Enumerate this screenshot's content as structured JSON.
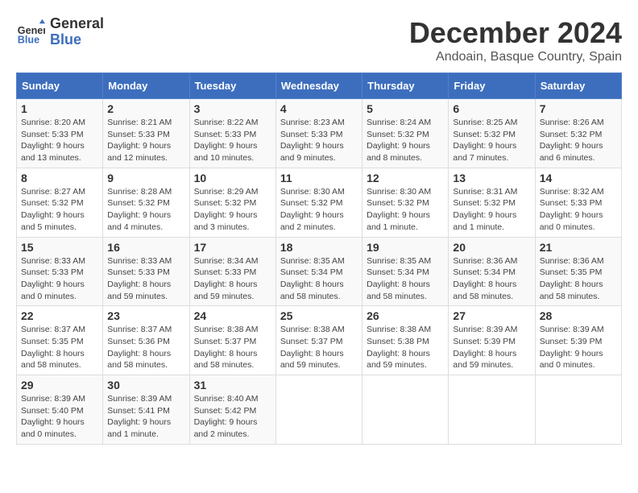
{
  "header": {
    "logo_line1": "General",
    "logo_line2": "Blue",
    "main_title": "December 2024",
    "subtitle": "Andoain, Basque Country, Spain"
  },
  "calendar": {
    "days_of_week": [
      "Sunday",
      "Monday",
      "Tuesday",
      "Wednesday",
      "Thursday",
      "Friday",
      "Saturday"
    ],
    "weeks": [
      [
        {
          "day": "1",
          "sunrise": "8:20 AM",
          "sunset": "5:33 PM",
          "daylight": "9 hours and 13 minutes."
        },
        {
          "day": "2",
          "sunrise": "8:21 AM",
          "sunset": "5:33 PM",
          "daylight": "9 hours and 12 minutes."
        },
        {
          "day": "3",
          "sunrise": "8:22 AM",
          "sunset": "5:33 PM",
          "daylight": "9 hours and 10 minutes."
        },
        {
          "day": "4",
          "sunrise": "8:23 AM",
          "sunset": "5:33 PM",
          "daylight": "9 hours and 9 minutes."
        },
        {
          "day": "5",
          "sunrise": "8:24 AM",
          "sunset": "5:32 PM",
          "daylight": "9 hours and 8 minutes."
        },
        {
          "day": "6",
          "sunrise": "8:25 AM",
          "sunset": "5:32 PM",
          "daylight": "9 hours and 7 minutes."
        },
        {
          "day": "7",
          "sunrise": "8:26 AM",
          "sunset": "5:32 PM",
          "daylight": "9 hours and 6 minutes."
        }
      ],
      [
        {
          "day": "8",
          "sunrise": "8:27 AM",
          "sunset": "5:32 PM",
          "daylight": "9 hours and 5 minutes."
        },
        {
          "day": "9",
          "sunrise": "8:28 AM",
          "sunset": "5:32 PM",
          "daylight": "9 hours and 4 minutes."
        },
        {
          "day": "10",
          "sunrise": "8:29 AM",
          "sunset": "5:32 PM",
          "daylight": "9 hours and 3 minutes."
        },
        {
          "day": "11",
          "sunrise": "8:30 AM",
          "sunset": "5:32 PM",
          "daylight": "9 hours and 2 minutes."
        },
        {
          "day": "12",
          "sunrise": "8:30 AM",
          "sunset": "5:32 PM",
          "daylight": "9 hours and 1 minute."
        },
        {
          "day": "13",
          "sunrise": "8:31 AM",
          "sunset": "5:32 PM",
          "daylight": "9 hours and 1 minute."
        },
        {
          "day": "14",
          "sunrise": "8:32 AM",
          "sunset": "5:33 PM",
          "daylight": "9 hours and 0 minutes."
        }
      ],
      [
        {
          "day": "15",
          "sunrise": "8:33 AM",
          "sunset": "5:33 PM",
          "daylight": "9 hours and 0 minutes."
        },
        {
          "day": "16",
          "sunrise": "8:33 AM",
          "sunset": "5:33 PM",
          "daylight": "8 hours and 59 minutes."
        },
        {
          "day": "17",
          "sunrise": "8:34 AM",
          "sunset": "5:33 PM",
          "daylight": "8 hours and 59 minutes."
        },
        {
          "day": "18",
          "sunrise": "8:35 AM",
          "sunset": "5:34 PM",
          "daylight": "8 hours and 58 minutes."
        },
        {
          "day": "19",
          "sunrise": "8:35 AM",
          "sunset": "5:34 PM",
          "daylight": "8 hours and 58 minutes."
        },
        {
          "day": "20",
          "sunrise": "8:36 AM",
          "sunset": "5:34 PM",
          "daylight": "8 hours and 58 minutes."
        },
        {
          "day": "21",
          "sunrise": "8:36 AM",
          "sunset": "5:35 PM",
          "daylight": "8 hours and 58 minutes."
        }
      ],
      [
        {
          "day": "22",
          "sunrise": "8:37 AM",
          "sunset": "5:35 PM",
          "daylight": "8 hours and 58 minutes."
        },
        {
          "day": "23",
          "sunrise": "8:37 AM",
          "sunset": "5:36 PM",
          "daylight": "8 hours and 58 minutes."
        },
        {
          "day": "24",
          "sunrise": "8:38 AM",
          "sunset": "5:37 PM",
          "daylight": "8 hours and 58 minutes."
        },
        {
          "day": "25",
          "sunrise": "8:38 AM",
          "sunset": "5:37 PM",
          "daylight": "8 hours and 59 minutes."
        },
        {
          "day": "26",
          "sunrise": "8:38 AM",
          "sunset": "5:38 PM",
          "daylight": "8 hours and 59 minutes."
        },
        {
          "day": "27",
          "sunrise": "8:39 AM",
          "sunset": "5:39 PM",
          "daylight": "8 hours and 59 minutes."
        },
        {
          "day": "28",
          "sunrise": "8:39 AM",
          "sunset": "5:39 PM",
          "daylight": "9 hours and 0 minutes."
        }
      ],
      [
        {
          "day": "29",
          "sunrise": "8:39 AM",
          "sunset": "5:40 PM",
          "daylight": "9 hours and 0 minutes."
        },
        {
          "day": "30",
          "sunrise": "8:39 AM",
          "sunset": "5:41 PM",
          "daylight": "9 hours and 1 minute."
        },
        {
          "day": "31",
          "sunrise": "8:40 AM",
          "sunset": "5:42 PM",
          "daylight": "9 hours and 2 minutes."
        },
        null,
        null,
        null,
        null
      ]
    ]
  }
}
